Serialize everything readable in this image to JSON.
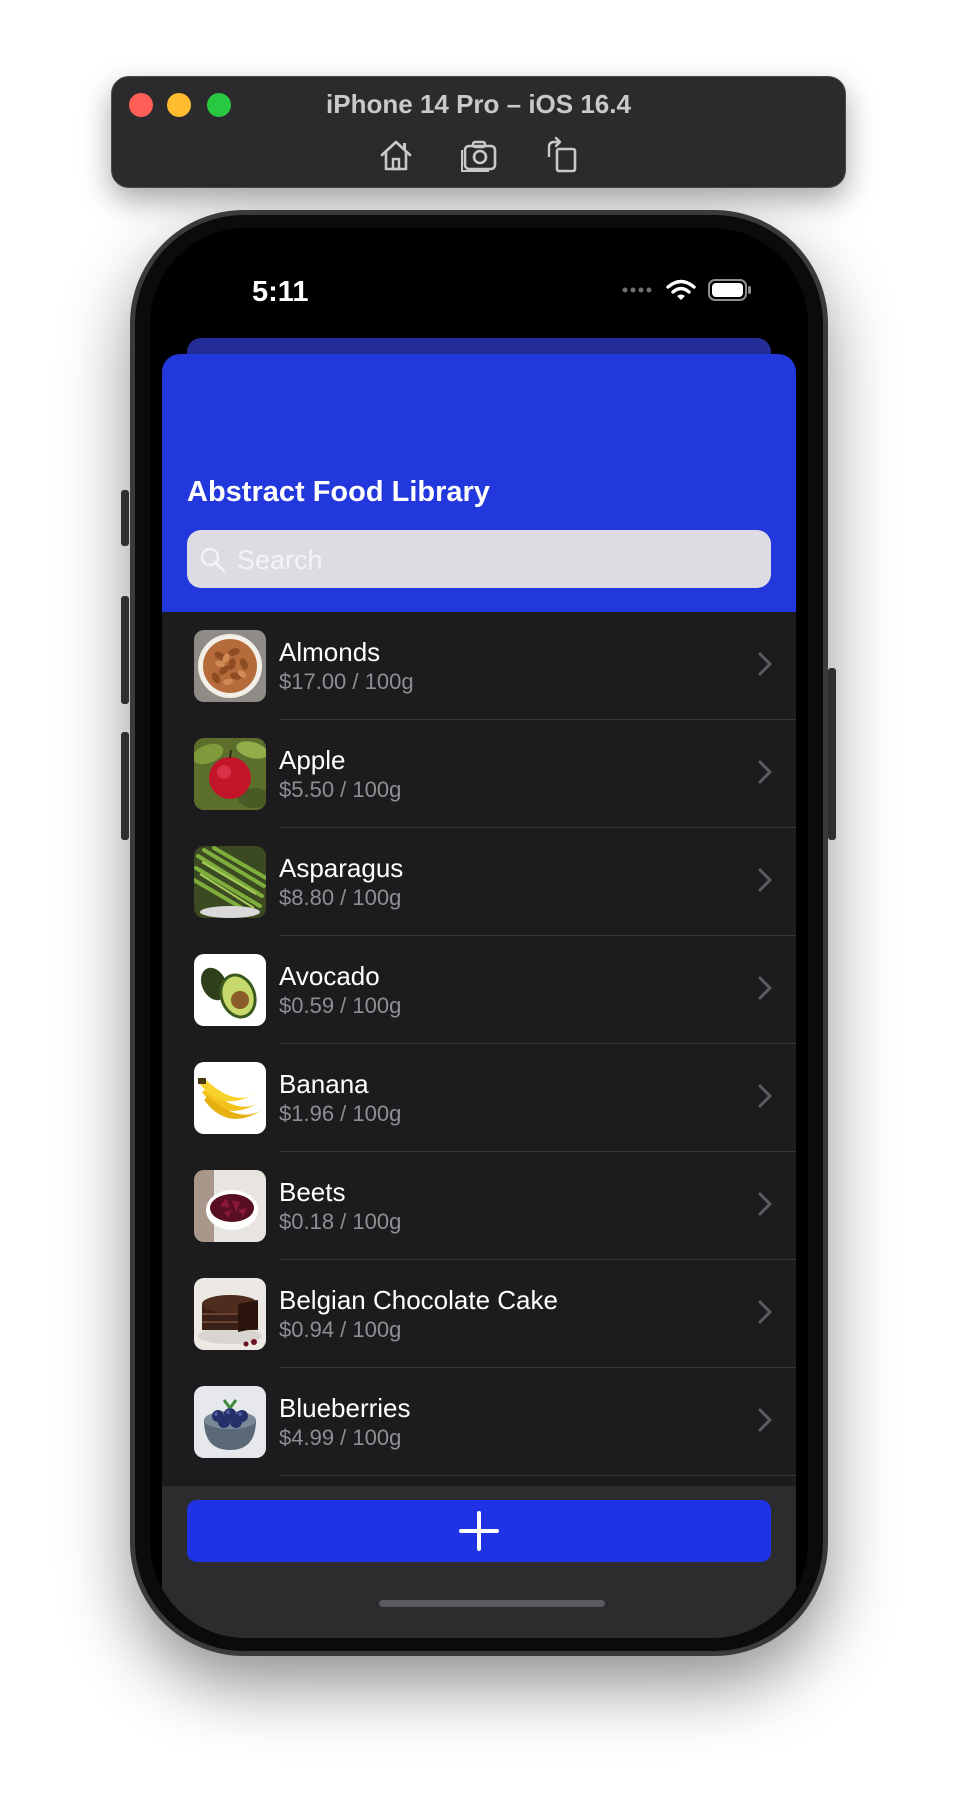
{
  "simulator": {
    "title": "iPhone 14 Pro – iOS 16.4",
    "tools": [
      "home-icon",
      "screenshot-icon",
      "rotate-icon"
    ]
  },
  "status_bar": {
    "time": "5:11",
    "icons": [
      "cellular-dots-icon",
      "wifi-icon",
      "battery-icon"
    ]
  },
  "header": {
    "title": "Abstract Food Library",
    "color": "#2237DC"
  },
  "search": {
    "placeholder": "Search",
    "value": ""
  },
  "foods": [
    {
      "name": "Almonds",
      "price": "$17.00 / 100g",
      "image": "almonds"
    },
    {
      "name": "Apple",
      "price": "$5.50 / 100g",
      "image": "apple"
    },
    {
      "name": "Asparagus",
      "price": "$8.80 / 100g",
      "image": "asparagus"
    },
    {
      "name": "Avocado",
      "price": "$0.59 / 100g",
      "image": "avocado"
    },
    {
      "name": "Banana",
      "price": "$1.96 / 100g",
      "image": "banana"
    },
    {
      "name": "Beets",
      "price": "$0.18 / 100g",
      "image": "beets"
    },
    {
      "name": "Belgian Chocolate Cake",
      "price": "$0.94 / 100g",
      "image": "chocolate-cake"
    },
    {
      "name": "Blueberries",
      "price": "$4.99 / 100g",
      "image": "blueberries"
    }
  ],
  "add_button": {
    "icon": "plus-icon",
    "color": "#1F32E4"
  }
}
